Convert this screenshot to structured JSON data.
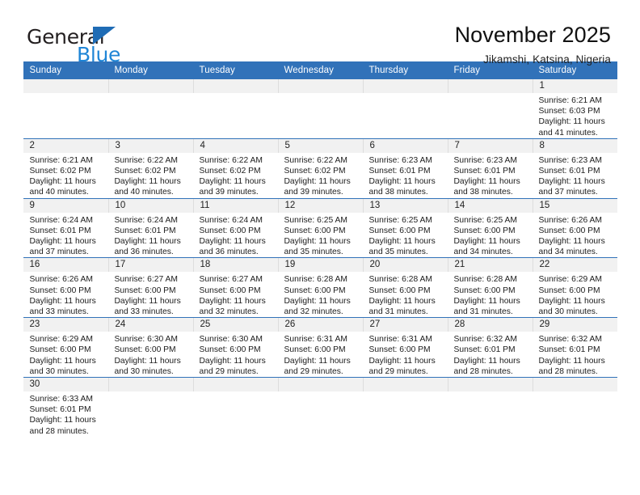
{
  "brand": {
    "name_top": "General",
    "name_bottom": "Blue",
    "triangle_color": "#1f6cb5",
    "blue_text_color": "#1f85d6"
  },
  "header": {
    "title": "November 2025",
    "subtitle": "Jikamshi, Katsina, Nigeria"
  },
  "theme": {
    "header_blue": "#3172b9",
    "row_divider": "#3172b9",
    "daynum_bg": "#f1f1f1"
  },
  "weekdays": [
    "Sunday",
    "Monday",
    "Tuesday",
    "Wednesday",
    "Thursday",
    "Friday",
    "Saturday"
  ],
  "labels": {
    "sunrise_prefix": "Sunrise:",
    "sunset_prefix": "Sunset:",
    "daylight_prefix": "Daylight:"
  },
  "weeks": [
    [
      {
        "empty": true
      },
      {
        "empty": true
      },
      {
        "empty": true
      },
      {
        "empty": true
      },
      {
        "empty": true
      },
      {
        "empty": true
      },
      {
        "day": "1",
        "sunrise": "Sunrise: 6:21 AM",
        "sunset": "Sunset: 6:03 PM",
        "daylight_line1": "Daylight: 11 hours",
        "daylight_line2": "and 41 minutes."
      }
    ],
    [
      {
        "day": "2",
        "sunrise": "Sunrise: 6:21 AM",
        "sunset": "Sunset: 6:02 PM",
        "daylight_line1": "Daylight: 11 hours",
        "daylight_line2": "and 40 minutes."
      },
      {
        "day": "3",
        "sunrise": "Sunrise: 6:22 AM",
        "sunset": "Sunset: 6:02 PM",
        "daylight_line1": "Daylight: 11 hours",
        "daylight_line2": "and 40 minutes."
      },
      {
        "day": "4",
        "sunrise": "Sunrise: 6:22 AM",
        "sunset": "Sunset: 6:02 PM",
        "daylight_line1": "Daylight: 11 hours",
        "daylight_line2": "and 39 minutes."
      },
      {
        "day": "5",
        "sunrise": "Sunrise: 6:22 AM",
        "sunset": "Sunset: 6:02 PM",
        "daylight_line1": "Daylight: 11 hours",
        "daylight_line2": "and 39 minutes."
      },
      {
        "day": "6",
        "sunrise": "Sunrise: 6:23 AM",
        "sunset": "Sunset: 6:01 PM",
        "daylight_line1": "Daylight: 11 hours",
        "daylight_line2": "and 38 minutes."
      },
      {
        "day": "7",
        "sunrise": "Sunrise: 6:23 AM",
        "sunset": "Sunset: 6:01 PM",
        "daylight_line1": "Daylight: 11 hours",
        "daylight_line2": "and 38 minutes."
      },
      {
        "day": "8",
        "sunrise": "Sunrise: 6:23 AM",
        "sunset": "Sunset: 6:01 PM",
        "daylight_line1": "Daylight: 11 hours",
        "daylight_line2": "and 37 minutes."
      }
    ],
    [
      {
        "day": "9",
        "sunrise": "Sunrise: 6:24 AM",
        "sunset": "Sunset: 6:01 PM",
        "daylight_line1": "Daylight: 11 hours",
        "daylight_line2": "and 37 minutes."
      },
      {
        "day": "10",
        "sunrise": "Sunrise: 6:24 AM",
        "sunset": "Sunset: 6:01 PM",
        "daylight_line1": "Daylight: 11 hours",
        "daylight_line2": "and 36 minutes."
      },
      {
        "day": "11",
        "sunrise": "Sunrise: 6:24 AM",
        "sunset": "Sunset: 6:00 PM",
        "daylight_line1": "Daylight: 11 hours",
        "daylight_line2": "and 36 minutes."
      },
      {
        "day": "12",
        "sunrise": "Sunrise: 6:25 AM",
        "sunset": "Sunset: 6:00 PM",
        "daylight_line1": "Daylight: 11 hours",
        "daylight_line2": "and 35 minutes."
      },
      {
        "day": "13",
        "sunrise": "Sunrise: 6:25 AM",
        "sunset": "Sunset: 6:00 PM",
        "daylight_line1": "Daylight: 11 hours",
        "daylight_line2": "and 35 minutes."
      },
      {
        "day": "14",
        "sunrise": "Sunrise: 6:25 AM",
        "sunset": "Sunset: 6:00 PM",
        "daylight_line1": "Daylight: 11 hours",
        "daylight_line2": "and 34 minutes."
      },
      {
        "day": "15",
        "sunrise": "Sunrise: 6:26 AM",
        "sunset": "Sunset: 6:00 PM",
        "daylight_line1": "Daylight: 11 hours",
        "daylight_line2": "and 34 minutes."
      }
    ],
    [
      {
        "day": "16",
        "sunrise": "Sunrise: 6:26 AM",
        "sunset": "Sunset: 6:00 PM",
        "daylight_line1": "Daylight: 11 hours",
        "daylight_line2": "and 33 minutes."
      },
      {
        "day": "17",
        "sunrise": "Sunrise: 6:27 AM",
        "sunset": "Sunset: 6:00 PM",
        "daylight_line1": "Daylight: 11 hours",
        "daylight_line2": "and 33 minutes."
      },
      {
        "day": "18",
        "sunrise": "Sunrise: 6:27 AM",
        "sunset": "Sunset: 6:00 PM",
        "daylight_line1": "Daylight: 11 hours",
        "daylight_line2": "and 32 minutes."
      },
      {
        "day": "19",
        "sunrise": "Sunrise: 6:28 AM",
        "sunset": "Sunset: 6:00 PM",
        "daylight_line1": "Daylight: 11 hours",
        "daylight_line2": "and 32 minutes."
      },
      {
        "day": "20",
        "sunrise": "Sunrise: 6:28 AM",
        "sunset": "Sunset: 6:00 PM",
        "daylight_line1": "Daylight: 11 hours",
        "daylight_line2": "and 31 minutes."
      },
      {
        "day": "21",
        "sunrise": "Sunrise: 6:28 AM",
        "sunset": "Sunset: 6:00 PM",
        "daylight_line1": "Daylight: 11 hours",
        "daylight_line2": "and 31 minutes."
      },
      {
        "day": "22",
        "sunrise": "Sunrise: 6:29 AM",
        "sunset": "Sunset: 6:00 PM",
        "daylight_line1": "Daylight: 11 hours",
        "daylight_line2": "and 30 minutes."
      }
    ],
    [
      {
        "day": "23",
        "sunrise": "Sunrise: 6:29 AM",
        "sunset": "Sunset: 6:00 PM",
        "daylight_line1": "Daylight: 11 hours",
        "daylight_line2": "and 30 minutes."
      },
      {
        "day": "24",
        "sunrise": "Sunrise: 6:30 AM",
        "sunset": "Sunset: 6:00 PM",
        "daylight_line1": "Daylight: 11 hours",
        "daylight_line2": "and 30 minutes."
      },
      {
        "day": "25",
        "sunrise": "Sunrise: 6:30 AM",
        "sunset": "Sunset: 6:00 PM",
        "daylight_line1": "Daylight: 11 hours",
        "daylight_line2": "and 29 minutes."
      },
      {
        "day": "26",
        "sunrise": "Sunrise: 6:31 AM",
        "sunset": "Sunset: 6:00 PM",
        "daylight_line1": "Daylight: 11 hours",
        "daylight_line2": "and 29 minutes."
      },
      {
        "day": "27",
        "sunrise": "Sunrise: 6:31 AM",
        "sunset": "Sunset: 6:00 PM",
        "daylight_line1": "Daylight: 11 hours",
        "daylight_line2": "and 29 minutes."
      },
      {
        "day": "28",
        "sunrise": "Sunrise: 6:32 AM",
        "sunset": "Sunset: 6:01 PM",
        "daylight_line1": "Daylight: 11 hours",
        "daylight_line2": "and 28 minutes."
      },
      {
        "day": "29",
        "sunrise": "Sunrise: 6:32 AM",
        "sunset": "Sunset: 6:01 PM",
        "daylight_line1": "Daylight: 11 hours",
        "daylight_line2": "and 28 minutes."
      }
    ],
    [
      {
        "day": "30",
        "sunrise": "Sunrise: 6:33 AM",
        "sunset": "Sunset: 6:01 PM",
        "daylight_line1": "Daylight: 11 hours",
        "daylight_line2": "and 28 minutes."
      },
      {
        "empty": true
      },
      {
        "empty": true
      },
      {
        "empty": true
      },
      {
        "empty": true
      },
      {
        "empty": true
      },
      {
        "empty": true
      }
    ]
  ]
}
